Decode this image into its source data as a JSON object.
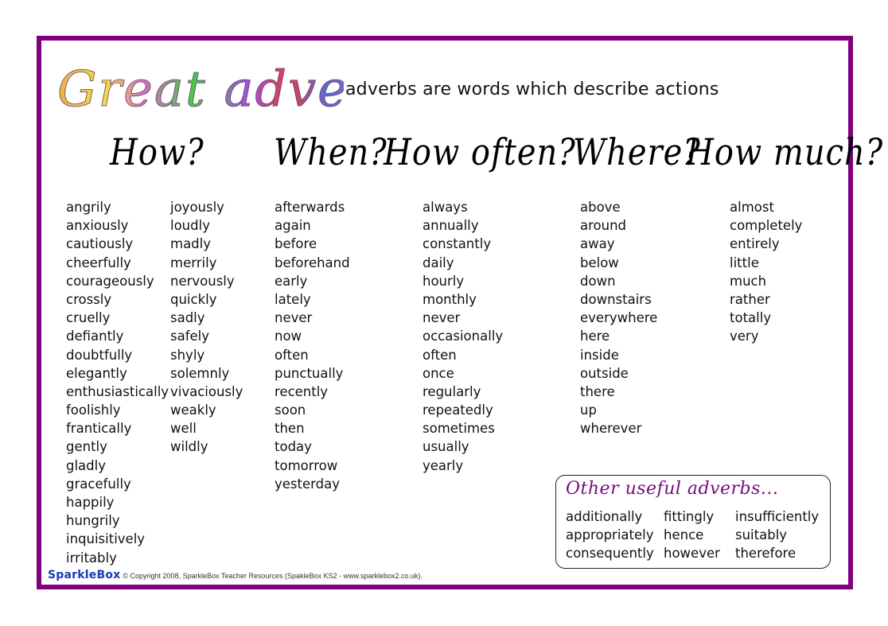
{
  "title": {
    "main": "Great adverbs!",
    "subtitle": "adverbs are words which describe actions"
  },
  "columns": {
    "how": {
      "heading": "How?",
      "words_a": [
        "angrily",
        "anxiously",
        "cautiously",
        "cheerfully",
        "courageously",
        "crossly",
        "cruelly",
        "defiantly",
        "doubtfully",
        "elegantly",
        "enthusiastically",
        "foolishly",
        "frantically",
        "gently",
        "gladly",
        "gracefully",
        "happily",
        "hungrily",
        "inquisitively",
        "irritably"
      ],
      "words_b": [
        "joyously",
        "loudly",
        "madly",
        "merrily",
        "nervously",
        "quickly",
        "sadly",
        "safely",
        "shyly",
        "solemnly",
        "vivaciously",
        "weakly",
        "well",
        "wildly"
      ]
    },
    "when": {
      "heading": "When?",
      "words": [
        "afterwards",
        "again",
        "before",
        "beforehand",
        "early",
        "lately",
        "never",
        "now",
        "often",
        "punctually",
        "recently",
        "soon",
        "then",
        "today",
        "tomorrow",
        "yesterday"
      ]
    },
    "how_often": {
      "heading": "How often?",
      "words": [
        "always",
        "annually",
        "constantly",
        "daily",
        "hourly",
        "monthly",
        "never",
        "occasionally",
        "often",
        "once",
        "regularly",
        "repeatedly",
        "sometimes",
        "usually",
        "yearly"
      ]
    },
    "where": {
      "heading": "Where?",
      "words": [
        "above",
        "around",
        "away",
        "below",
        "down",
        "downstairs",
        "everywhere",
        "here",
        "inside",
        "outside",
        "there",
        "up",
        "wherever"
      ]
    },
    "how_much": {
      "heading": "How much?",
      "words": [
        "almost",
        "completely",
        "entirely",
        "little",
        "much",
        "rather",
        "totally",
        "very"
      ]
    }
  },
  "other_box": {
    "title": "Other useful adverbs...",
    "col1": [
      "additionally",
      "appropriately",
      "consequently"
    ],
    "col2": [
      "fittingly",
      "hence",
      "however"
    ],
    "col3": [
      "insufficiently",
      "suitably",
      "therefore"
    ]
  },
  "footer": {
    "brand": "SparkleBox",
    "copyright": "© Copyright 2008, SparkleBox Teacher Resources (SpakleBox KS2 - www.sparklebox2.co.uk)."
  },
  "colors": {
    "frame": "#800080",
    "box_title": "#7a0a7a",
    "brand": "#1a3cb4"
  }
}
